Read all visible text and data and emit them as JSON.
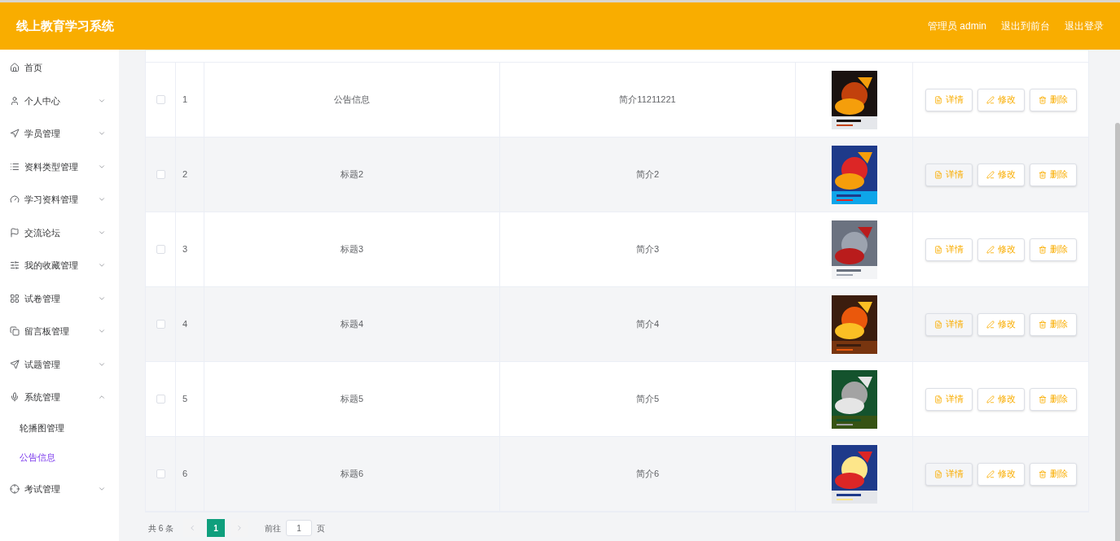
{
  "header": {
    "title": "线上教育学习系统",
    "user": "管理员 admin",
    "links": [
      "退出到前台",
      "退出登录"
    ]
  },
  "sidebar": {
    "items": [
      {
        "label": "首页",
        "kind": "link"
      },
      {
        "label": "个人中心",
        "kind": "menu",
        "expanded": false
      },
      {
        "label": "学员管理",
        "kind": "menu",
        "expanded": false
      },
      {
        "label": "资料类型管理",
        "kind": "menu",
        "expanded": false
      },
      {
        "label": "学习资料管理",
        "kind": "menu",
        "expanded": false
      },
      {
        "label": "交流论坛",
        "kind": "menu",
        "expanded": false
      },
      {
        "label": "我的收藏管理",
        "kind": "menu",
        "expanded": false
      },
      {
        "label": "试卷管理",
        "kind": "menu",
        "expanded": false
      },
      {
        "label": "留言板管理",
        "kind": "menu",
        "expanded": false
      },
      {
        "label": "试题管理",
        "kind": "menu",
        "expanded": false
      },
      {
        "label": "系统管理",
        "kind": "menu",
        "expanded": true,
        "children": [
          {
            "label": "轮播图管理",
            "selected": false
          },
          {
            "label": "公告信息",
            "selected": true
          }
        ]
      },
      {
        "label": "考试管理",
        "kind": "menu",
        "expanded": false
      }
    ]
  },
  "table": {
    "rows": [
      {
        "checked": false,
        "index": "1",
        "title": "公告信息",
        "intro": "简介11211221",
        "actions": [
          "详情",
          "修改",
          "删除"
        ]
      },
      {
        "checked": false,
        "index": "2",
        "title": "标题2",
        "intro": "简介2",
        "actions": [
          "详情",
          "修改",
          "删除"
        ]
      },
      {
        "checked": false,
        "index": "3",
        "title": "标题3",
        "intro": "简介3",
        "actions": [
          "详情",
          "修改",
          "删除"
        ]
      },
      {
        "checked": false,
        "index": "4",
        "title": "标题4",
        "intro": "简介4",
        "actions": [
          "详情",
          "修改",
          "删除"
        ]
      },
      {
        "checked": false,
        "index": "5",
        "title": "标题5",
        "intro": "简介5",
        "actions": [
          "详情",
          "修改",
          "删除"
        ]
      },
      {
        "checked": false,
        "index": "6",
        "title": "标题6",
        "intro": "简介6",
        "actions": [
          "详情",
          "修改",
          "删除"
        ]
      }
    ]
  },
  "pagination": {
    "total": "共 6 条",
    "pages": [
      {
        "label": "1",
        "selected": true
      }
    ],
    "goto": "前往",
    "page_input": "1",
    "page_suffix": "页"
  }
}
